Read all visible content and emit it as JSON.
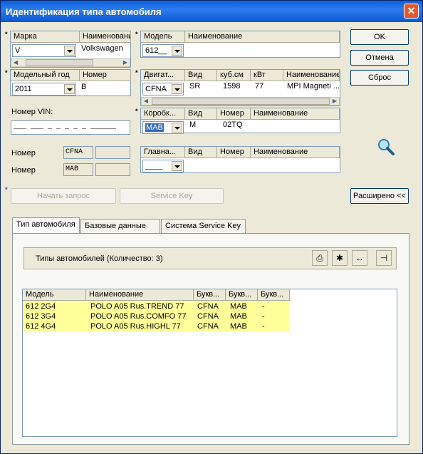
{
  "window": {
    "title": "Идентификация типа автомобиля",
    "close": "✕"
  },
  "marka": {
    "col1": "Марка",
    "col2": "Наименовани",
    "value": "V",
    "name": "Volkswagen"
  },
  "model": {
    "col1": "Модель",
    "col2": "Наименование",
    "value": "612__"
  },
  "year": {
    "col1": "Модельный год",
    "col2": "Номер",
    "value": "2011",
    "number": "B"
  },
  "engine": {
    "cols": [
      "Двигат...",
      "Вид",
      "куб.см",
      "кВт",
      "Наименование"
    ],
    "value": "CFNA",
    "vid": "SR",
    "ccm": "1598",
    "kw": "77",
    "name": "MPI Magneti ..."
  },
  "gearbox": {
    "cols": [
      "Коробк...",
      "Вид",
      "Номер",
      "Наименование"
    ],
    "value": "MAB",
    "vid": "M",
    "number": "02TQ"
  },
  "main": {
    "cols": [
      "Главна...",
      "Вид",
      "Номер",
      "Наименование"
    ],
    "value": "____"
  },
  "vin": {
    "label": "Номер VIN:",
    "mask": "___ ___ _ _ _ _ _ ______"
  },
  "nomer1": {
    "label": "Номер",
    "value": "CFNA"
  },
  "nomer2": {
    "label": "Номер",
    "value": "MAB"
  },
  "buttons": {
    "ok": "OK",
    "cancel": "Отмена",
    "reset": "Сброс",
    "start": "Начать запрос",
    "service_key": "Service Key",
    "expand": "Расширено <<"
  },
  "tabs": [
    "Тип автомобиля",
    "Базовые данные",
    "Система Service Key"
  ],
  "types": {
    "title": "Типы автомобилей (Количество: 3)"
  },
  "table": {
    "headers": [
      "Модель",
      "Наименование",
      "Букв...",
      "Букв...",
      "Букв..."
    ],
    "rows": [
      [
        "612 2G4",
        "POLO A05 Rus.TREND 77",
        "CFNA",
        "MAB",
        "-"
      ],
      [
        "612 3G4",
        "POLO A05 Rus.COMFO 77",
        "CFNA",
        "MAB",
        "-"
      ],
      [
        "612 4G4",
        "POLO A05 Rus.HIGHL 77",
        "CFNA",
        "MAB",
        "-"
      ]
    ]
  },
  "colors": {
    "titlebar": "#0a5fd8",
    "highlight": "#ffff99",
    "selected": "#316ac5"
  },
  "icons": [
    "magnifier-icon",
    "print-icon",
    "settings-icon",
    "compare-icon",
    "pin-icon"
  ]
}
